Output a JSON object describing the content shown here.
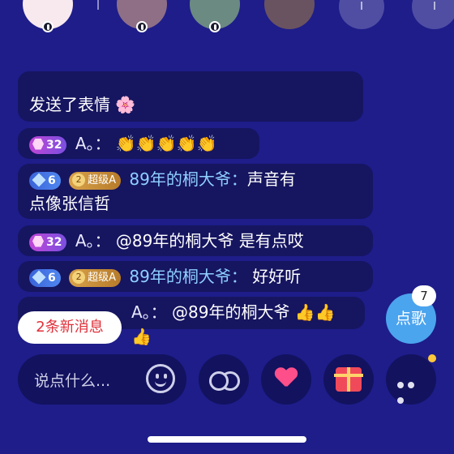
{
  "colors": {
    "background": "#1e1d8a",
    "name_highlight": "#8fd0ff",
    "new_msg_text": "#e0303a",
    "song_button": "#4ba4ee",
    "notify_dot": "#ffc83a"
  },
  "top": {
    "avatars": [
      "avatar-1",
      "avatar-2",
      "avatar-3",
      "avatar-4"
    ]
  },
  "messages": [
    {
      "partial_top": "发送了表情",
      "emoji": "🌸"
    },
    {
      "level": "32",
      "name": "A。：",
      "emojis": "👏👏👏👏👏"
    },
    {
      "level": "6",
      "fan_level": "2",
      "fan_title": "超级A",
      "name": "89年的桐大爷：",
      "text_line1": "声音有",
      "text_line2": "点像张信哲"
    },
    {
      "level": "32",
      "name": "A。：",
      "text": "@89年的桐大爷 是有点哎"
    },
    {
      "level": "6",
      "fan_level": "2",
      "fan_title": "超级A",
      "name": "89年的桐大爷：",
      "text": "好好听"
    },
    {
      "name": "A。：",
      "text": "@89年的桐大爷",
      "emojis": "👍👍👍"
    }
  ],
  "new_messages_pill": "2条新消息",
  "song_button": {
    "label": "点歌",
    "count": "7"
  },
  "input": {
    "placeholder": "说点什么..."
  },
  "toolbar": {
    "emoji_icon": "smile-icon",
    "link_icon": "link-icon",
    "like_icon": "heart-icon",
    "gift_icon": "gift-icon",
    "more_icon": "more-icon"
  }
}
